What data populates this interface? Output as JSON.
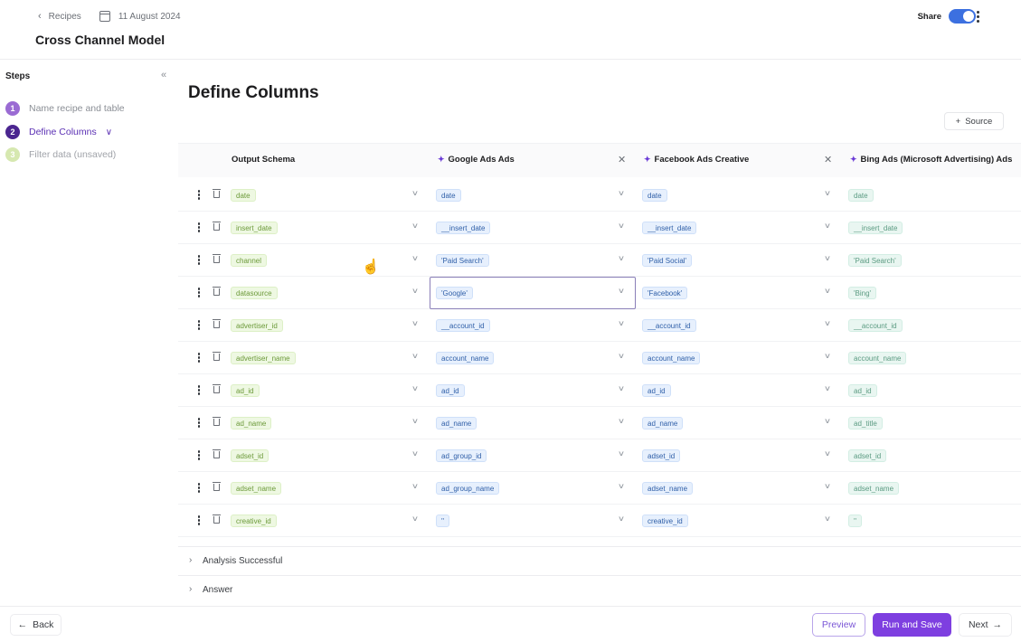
{
  "header": {
    "breadcrumb_back": "Recipes",
    "date": "11 August 2024",
    "title": "Cross Channel Model",
    "share_label": "Share",
    "share_on": true
  },
  "sidebar": {
    "heading": "Steps",
    "steps": [
      {
        "num": "1",
        "label": "Name recipe and table"
      },
      {
        "num": "2",
        "label": "Define Columns",
        "active": true
      },
      {
        "num": "3",
        "label": "Filter data (unsaved)"
      }
    ]
  },
  "main": {
    "title": "Define Columns",
    "source_button": "Source",
    "columns": [
      {
        "label": "Output Schema"
      },
      {
        "label": "Google Ads Ads"
      },
      {
        "label": "Facebook Ads Creative"
      },
      {
        "label": "Bing Ads (Microsoft Advertising) Ads"
      }
    ],
    "rows": [
      {
        "output": "date",
        "google": "date",
        "facebook": "date",
        "bing": "date"
      },
      {
        "output": "insert_date",
        "google": "__insert_date",
        "facebook": "__insert_date",
        "bing": "__insert_date"
      },
      {
        "output": "channel",
        "google": "'Paid Search'",
        "facebook": "'Paid Social'",
        "bing": "'Paid Search'"
      },
      {
        "output": "datasource",
        "google": "'Google'",
        "facebook": "'Facebook'",
        "bing": "'Bing'"
      },
      {
        "output": "advertiser_id",
        "google": "__account_id",
        "facebook": "__account_id",
        "bing": "__account_id"
      },
      {
        "output": "advertiser_name",
        "google": "account_name",
        "facebook": "account_name",
        "bing": "account_name"
      },
      {
        "output": "ad_id",
        "google": "ad_id",
        "facebook": "ad_id",
        "bing": "ad_id"
      },
      {
        "output": "ad_name",
        "google": "ad_name",
        "facebook": "ad_name",
        "bing": "ad_title"
      },
      {
        "output": "adset_id",
        "google": "ad_group_id",
        "facebook": "adset_id",
        "bing": "adset_id"
      },
      {
        "output": "adset_name",
        "google": "ad_group_name",
        "facebook": "adset_name",
        "bing": "adset_name"
      },
      {
        "output": "creative_id",
        "google": "''",
        "facebook": "creative_id",
        "bing": "''"
      }
    ],
    "accordions": [
      "Analysis Successful",
      "Answer"
    ]
  },
  "footer": {
    "back": "Back",
    "preview": "Preview",
    "run_and_save": "Run and Save",
    "next": "Next"
  },
  "colors": {
    "accent": "#7e3fe0",
    "toggle": "#3c70e0"
  }
}
